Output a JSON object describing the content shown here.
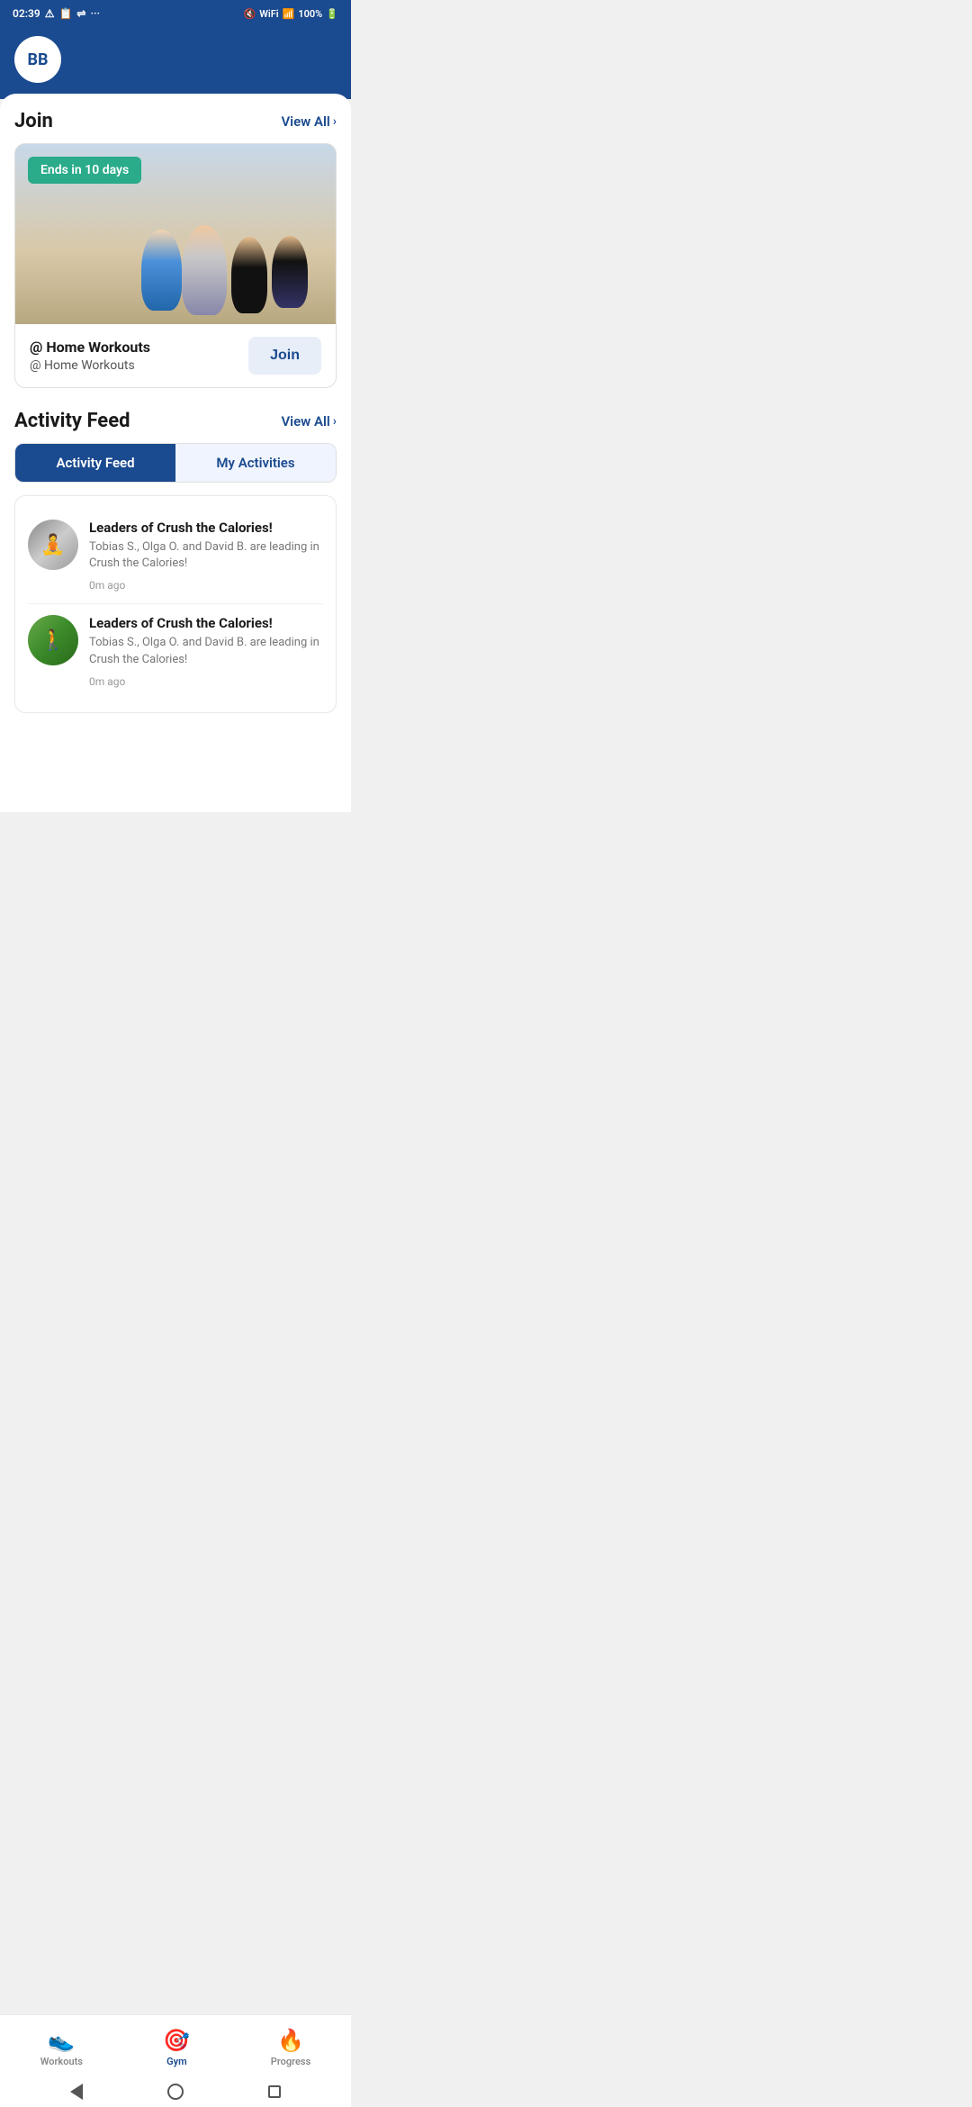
{
  "statusBar": {
    "time": "02:39",
    "battery": "100%",
    "batteryIcon": "🔋"
  },
  "header": {
    "avatarInitials": "BB"
  },
  "join": {
    "sectionTitle": "Join",
    "viewAllLabel": "View All",
    "badge": "Ends in 10 days",
    "challengeName": "@ Home Workouts",
    "challengeSubtitle": "@ Home Workouts",
    "joinButtonLabel": "Join"
  },
  "activityFeed": {
    "sectionTitle": "Activity Feed",
    "viewAllLabel": "View All",
    "tabs": [
      {
        "id": "feed",
        "label": "Activity Feed",
        "active": true
      },
      {
        "id": "my",
        "label": "My Activities",
        "active": false
      }
    ],
    "items": [
      {
        "id": 1,
        "title": "Leaders of Crush the Calories!",
        "description": "Tobias S., Olga O. and David B. are leading in Crush the Calories!",
        "time": "0m ago",
        "avatarType": "yoga"
      },
      {
        "id": 2,
        "title": "Leaders of Crush the Calories!",
        "description": "Tobias S., Olga O. and David B. are leading in Crush the Calories!",
        "time": "0m ago",
        "avatarType": "walking"
      }
    ]
  },
  "bottomNav": {
    "items": [
      {
        "id": "workouts",
        "label": "Workouts",
        "icon": "👟",
        "active": false
      },
      {
        "id": "gym",
        "label": "Gym",
        "icon": "🎯",
        "active": true
      },
      {
        "id": "progress",
        "label": "Progress",
        "icon": "🔥",
        "active": false
      }
    ]
  }
}
